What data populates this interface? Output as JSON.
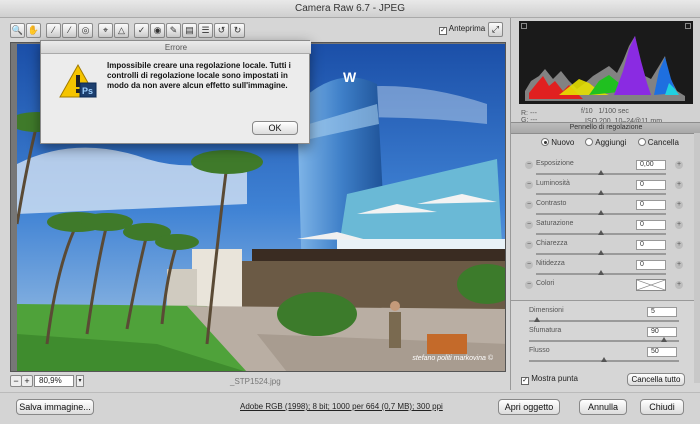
{
  "window": {
    "title": "Camera Raw 6.7  -  JPEG"
  },
  "toolbar": {
    "tools": [
      "zoom-icon",
      "hand-icon",
      "white-balance-icon",
      "color-sampler-icon",
      "target-adjust-icon",
      "crop-icon",
      "straighten-icon",
      "spot-removal-icon",
      "red-eye-icon",
      "adjustment-brush-icon",
      "graduated-filter-icon",
      "preferences-icon",
      "rotate-ccw-icon",
      "rotate-cw-icon"
    ],
    "preview_label": "Anteprima",
    "preview_checked": true
  },
  "dialog": {
    "title": "Errore",
    "message": "Impossibile creare una regolazione locale. Tutti i controlli di regolazione locale sono impostati in modo da non avere alcun effetto sull'immagine.",
    "ok_label": "OK"
  },
  "image": {
    "credit": "stefano politi markovina ©",
    "filename": "_STP1524.jpg"
  },
  "zoom": {
    "value": "80,9%"
  },
  "histogram_info": {
    "r_label": "R:",
    "r_value": "---",
    "g_label": "G:",
    "g_value": "---",
    "b_label": "B:",
    "b_value": "---",
    "aperture": "f/10",
    "shutter": "1/100 sec",
    "iso": "ISO 200",
    "lens": "10–24@11 mm"
  },
  "panel": {
    "title": "Pennello di regolazione",
    "modes": [
      {
        "label": "Nuovo",
        "selected": true
      },
      {
        "label": "Aggiungi",
        "selected": false
      },
      {
        "label": "Cancella",
        "selected": false
      }
    ],
    "params": [
      {
        "label": "Esposizione",
        "value": "0,00",
        "fraction": 0.5
      },
      {
        "label": "Luminosità",
        "value": "0",
        "fraction": 0.5
      },
      {
        "label": "Contrasto",
        "value": "0",
        "fraction": 0.5
      },
      {
        "label": "Saturazione",
        "value": "0",
        "fraction": 0.5
      },
      {
        "label": "Chiarezza",
        "value": "0",
        "fraction": 0.5
      },
      {
        "label": "Nitidezza",
        "value": "0",
        "fraction": 0.5
      }
    ],
    "color_label": "Colori",
    "brush": [
      {
        "label": "Dimensioni",
        "value": "5",
        "fraction": 0.05
      },
      {
        "label": "Sfumatura",
        "value": "90",
        "fraction": 0.9
      },
      {
        "label": "Flusso",
        "value": "50",
        "fraction": 0.5
      }
    ],
    "show_pins_label": "Mostra punta",
    "show_pins_checked": true,
    "clear_all_label": "Cancella tutto"
  },
  "bottom": {
    "save_label": "Salva immagine...",
    "workflow": "Adobe RGB (1998); 8 bit; 1000 per 664 (0,7 MB); 300 ppi",
    "open_label": "Apri oggetto",
    "cancel_label": "Annulla",
    "done_label": "Chiudi"
  }
}
